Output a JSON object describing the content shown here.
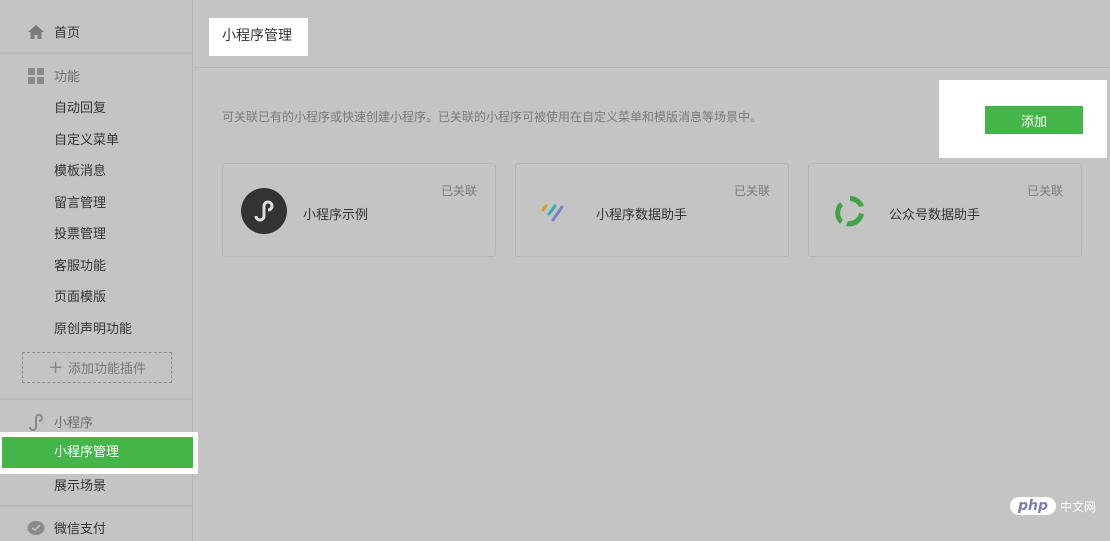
{
  "sidebar": {
    "home": "首页",
    "features": "功能",
    "feature_items": [
      "自动回复",
      "自定义菜单",
      "模板消息",
      "留言管理",
      "投票管理",
      "客服功能",
      "页面模版",
      "原创声明功能"
    ],
    "add_plugin": "添加功能插件",
    "miniprogram": "小程序",
    "mp_items": [
      "小程序管理",
      "展示场景"
    ],
    "pay": "微信支付"
  },
  "main": {
    "title": "小程序管理",
    "description": "可关联已有的小程序或快速创建小程序。已关联的小程序可被使用在自定义菜单和模版消息等场景中。",
    "add_button": "添加",
    "cards": [
      {
        "name": "小程序示例",
        "status": "已关联",
        "icon": "miniprogram-logo-icon"
      },
      {
        "name": "小程序数据助手",
        "status": "已关联",
        "icon": "data-assistant-icon"
      },
      {
        "name": "公众号数据助手",
        "status": "已关联",
        "icon": "mp-data-assistant-icon"
      }
    ]
  },
  "watermark": {
    "logo": "php",
    "text": "中文网"
  },
  "colors": {
    "accent": "#44b549"
  }
}
